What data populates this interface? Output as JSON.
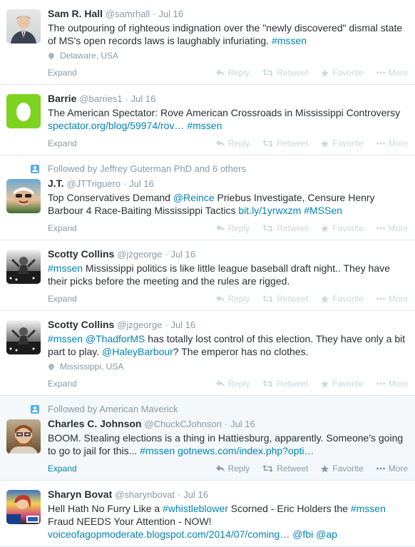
{
  "tweets": [
    {
      "name": "Sam R. Hall",
      "handle": "@samrhall",
      "dot": "·",
      "time": "Jul 16",
      "context": "",
      "text_parts": [
        {
          "t": "The outpouring of righteous indignation over the \"newly discovered\" dismal state of MS's open records laws is laughably infuriating. ",
          "link": false
        },
        {
          "t": "#mssen",
          "link": true
        }
      ],
      "location": "Delaware, USA"
    },
    {
      "name": "Barrie",
      "handle": "@barries1",
      "dot": "·",
      "time": "Jul 16",
      "context": "",
      "text_parts": [
        {
          "t": "The American Spectator:  Rove American Crossroads in Mississippi  Controversy ",
          "link": false
        },
        {
          "t": "spectator.org/blog/59974/rov…",
          "link": true
        },
        {
          "t": " ",
          "link": false
        },
        {
          "t": "#mssen",
          "link": true
        }
      ],
      "location": ""
    },
    {
      "name": "J.T.",
      "handle": "@JTTriguero",
      "dot": "·",
      "time": "Jul 16",
      "context": "Followed by Jeffrey Guterman PhD and 6 others",
      "text_parts": [
        {
          "t": "Top Conservatives Demand ",
          "link": false
        },
        {
          "t": "@Reince",
          "link": true
        },
        {
          "t": " Priebus Investigate, Censure Henry Barbour 4 Race-Baiting Mississippi Tactics ",
          "link": false
        },
        {
          "t": "bit.ly/1yrwxzm",
          "link": true
        },
        {
          "t": " ",
          "link": false
        },
        {
          "t": "#MSSen",
          "link": true
        }
      ],
      "location": ""
    },
    {
      "name": "Scotty Collins",
      "handle": "@jzgeorge",
      "dot": "·",
      "time": "Jul 16",
      "context": "",
      "text_parts": [
        {
          "t": "#mssen",
          "link": true
        },
        {
          "t": " Mississippi politics is like little league baseball draft night.. They have their picks before the meeting and the rules are rigged.",
          "link": false
        }
      ],
      "location": ""
    },
    {
      "name": "Scotty Collins",
      "handle": "@jzgeorge",
      "dot": "·",
      "time": "Jul 16",
      "context": "",
      "text_parts": [
        {
          "t": "#mssen",
          "link": true
        },
        {
          "t": " ",
          "link": false
        },
        {
          "t": "@ThadforMS",
          "link": true
        },
        {
          "t": " has totally lost control of this election. They have only a bit part to play. ",
          "link": false
        },
        {
          "t": "@HaleyBarbour",
          "link": true
        },
        {
          "t": "? The emperor has no clothes.",
          "link": false
        }
      ],
      "location": "Mississippi, USA"
    },
    {
      "name": "Charles C. Johnson",
      "handle": "@ChuckCJohnson",
      "dot": "·",
      "time": "Jul 16",
      "context": "Followed by American Maverick",
      "text_parts": [
        {
          "t": "BOOM. Stealing elections is a thing in Hattiesburg, apparently. Someone's going to go to jail for this... ",
          "link": false
        },
        {
          "t": "#mssen",
          "link": true
        },
        {
          "t": " ",
          "link": false
        },
        {
          "t": "gotnews.com/index.php?opti…",
          "link": true
        }
      ],
      "location": ""
    },
    {
      "name": "Sharyn Bovat",
      "handle": "@sharynbovat",
      "dot": "·",
      "time": "Jul 16",
      "context": "",
      "text_parts": [
        {
          "t": "Hell Hath No Furry Like a ",
          "link": false
        },
        {
          "t": "#whistleblower",
          "link": true
        },
        {
          "t": " Scorned - Eric Holders the ",
          "link": false
        },
        {
          "t": "#mssen",
          "link": true
        },
        {
          "t": " Fraud NEEDS Your Attention - NOW! ",
          "link": false
        },
        {
          "t": "voiceofagopmoderate.blogspot.com/2014/07/coming…",
          "link": true
        },
        {
          "t": " ",
          "link": false
        },
        {
          "t": "@fbi",
          "link": true
        },
        {
          "t": " ",
          "link": false
        },
        {
          "t": "@ap",
          "link": true
        }
      ],
      "location": ""
    }
  ],
  "actions": {
    "expand": "Expand",
    "reply": "Reply",
    "retweet": "Retweet",
    "favorite": "Favorite",
    "more": "More"
  },
  "colors": {
    "link": "#0084b4",
    "muted": "#8899a6",
    "hover_bg": "#f5f8fa"
  }
}
